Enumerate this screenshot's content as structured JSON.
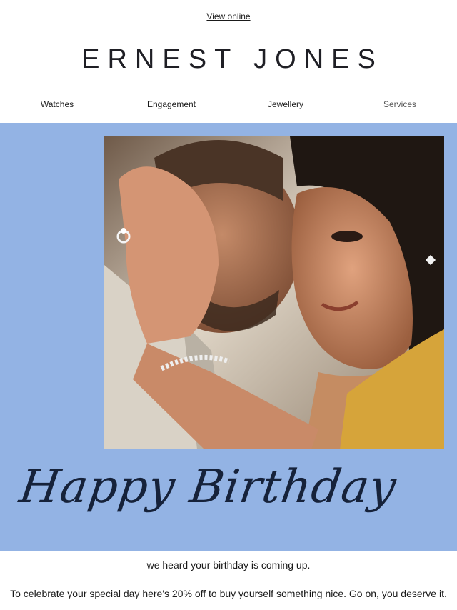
{
  "header": {
    "view_online": "View online",
    "brand": "ERNEST JONES"
  },
  "nav": {
    "items": [
      "Watches",
      "Engagement",
      "Jewellery",
      "Services"
    ]
  },
  "hero": {
    "background": "#93b3e4",
    "headline": "Happy Birthday",
    "image_subject": "couple embracing, woman wearing ring, bracelet and earring"
  },
  "body": {
    "line1": "we heard your birthday is coming up.",
    "line2": "To celebrate your special day here's 20% off to buy yourself something nice. Go on, you deserve it."
  },
  "colors": {
    "hero_blue": "#93b3e4",
    "headline_ink": "#16223a"
  }
}
